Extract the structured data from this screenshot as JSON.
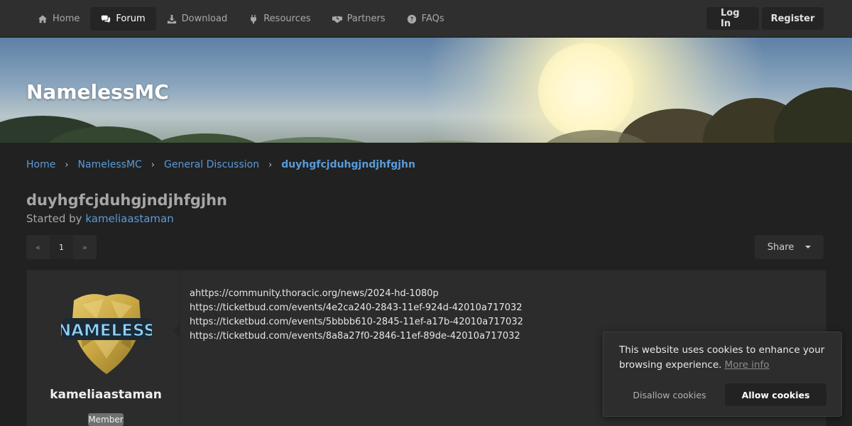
{
  "nav": {
    "items": [
      {
        "label": "Home",
        "icon": "home-icon"
      },
      {
        "label": "Forum",
        "icon": "comments-icon",
        "active": true
      },
      {
        "label": "Download",
        "icon": "download-icon"
      },
      {
        "label": "Resources",
        "icon": "plug-icon"
      },
      {
        "label": "Partners",
        "icon": "handshake-icon"
      },
      {
        "label": "FAQs",
        "icon": "question-circle-icon"
      }
    ],
    "login": "Log In",
    "register": "Register"
  },
  "banner": {
    "title": "NamelessMC"
  },
  "breadcrumb": [
    "Home",
    "NamelessMC",
    "General Discussion",
    "duyhgfcjduhgjndjhfgjhn"
  ],
  "topic": {
    "title": "duyhgfcjduhgjndjhfgjhn",
    "started_by_prefix": "Started by",
    "author": "kameliaastaman"
  },
  "pagination": {
    "prev": "«",
    "current": "1",
    "next": "»"
  },
  "share": {
    "label": "Share"
  },
  "post": {
    "avatar_text": "NAMELESS",
    "username": "kameliaastaman",
    "role": "Member",
    "lines": [
      "ahttps://community.thoracic.org/news/2024-hd-1080p",
      "https://ticketbud.com/events/4e2ca240-2843-11ef-924d-42010a717032",
      "https://ticketbud.com/events/5bbbb610-2845-11ef-a17b-42010a717032",
      "https://ticketbud.com/events/8a8a27f0-2846-11ef-89de-42010a717032"
    ]
  },
  "cookie": {
    "message": "This website uses cookies to enhance your browsing experience.",
    "more_info": "More info",
    "deny": "Disallow cookies",
    "allow": "Allow cookies"
  },
  "colors": {
    "link": "#5a9bd8",
    "navbar": "#2f2f2f",
    "body": "#212121"
  }
}
